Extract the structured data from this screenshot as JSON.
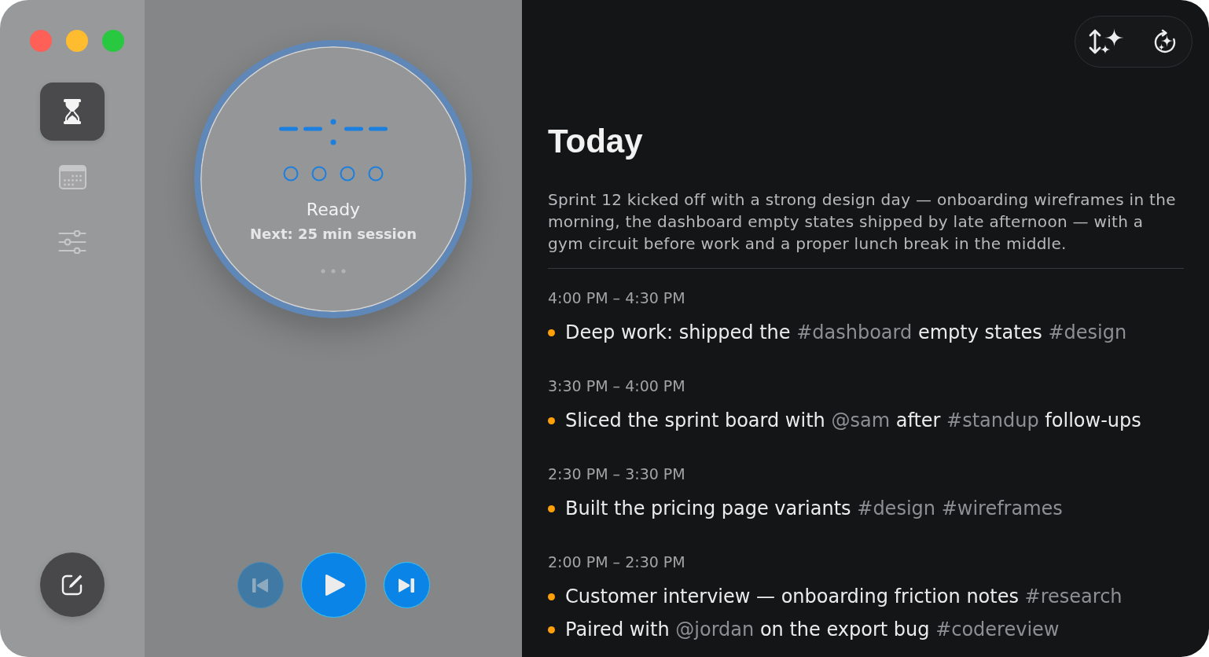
{
  "window_controls": [
    {
      "color": "#fe5f57"
    },
    {
      "color": "#febc2e"
    },
    {
      "color": "#28c840"
    }
  ],
  "sidebar": {
    "nav": [
      {
        "kind": "timer",
        "selected": true
      },
      {
        "kind": "calendar",
        "selected": false
      },
      {
        "kind": "settings",
        "selected": false
      }
    ]
  },
  "timer": {
    "sessions": [
      {
        "completed": false
      },
      {
        "completed": false
      },
      {
        "completed": false
      },
      {
        "completed": false
      }
    ],
    "status": "Ready",
    "next_session": "Next: 25 min session",
    "controls": [
      {
        "kind": "previous",
        "disabled": true
      },
      {
        "kind": "play",
        "disabled": false
      },
      {
        "kind": "next",
        "disabled": false
      }
    ]
  },
  "journal": {
    "title": "Today",
    "summary": "Sprint 12 kicked off with a strong design day — onboarding wireframes in the morning, the dashboard empty states shipped by late afternoon — with a gym circuit before work and a proper lunch break in the middle.",
    "groups": [
      {
        "time": "4:00 PM – 4:30 PM",
        "entries": [
          {
            "parts": [
              {
                "kind": "text",
                "text": "Deep work: shipped the"
              },
              {
                "kind": "tag",
                "text": "#dashboard"
              },
              {
                "kind": "text",
                "text": "empty states"
              },
              {
                "kind": "tag",
                "text": "#design"
              }
            ]
          }
        ]
      },
      {
        "time": "3:30 PM – 4:00 PM",
        "entries": [
          {
            "parts": [
              {
                "kind": "text",
                "text": "Sliced the sprint board with"
              },
              {
                "kind": "mention",
                "text": "@sam"
              },
              {
                "kind": "text",
                "text": "after"
              },
              {
                "kind": "tag",
                "text": "#standup"
              },
              {
                "kind": "text",
                "text": "follow-ups"
              }
            ]
          }
        ]
      },
      {
        "time": "2:30 PM – 3:30 PM",
        "entries": [
          {
            "parts": [
              {
                "kind": "text",
                "text": "Built the pricing page variants"
              },
              {
                "kind": "tag",
                "text": "#design"
              },
              {
                "kind": "tag",
                "text": "#wireframes"
              }
            ]
          }
        ]
      },
      {
        "time": "2:00 PM – 2:30 PM",
        "entries": [
          {
            "parts": [
              {
                "kind": "text",
                "text": "Customer interview — onboarding friction notes"
              },
              {
                "kind": "tag",
                "text": "#research"
              }
            ]
          },
          {
            "parts": [
              {
                "kind": "text",
                "text": "Paired with"
              },
              {
                "kind": "mention",
                "text": "@jordan"
              },
              {
                "kind": "text",
                "text": "on the export bug"
              },
              {
                "kind": "tag",
                "text": "#codereview"
              }
            ]
          }
        ]
      }
    ]
  }
}
